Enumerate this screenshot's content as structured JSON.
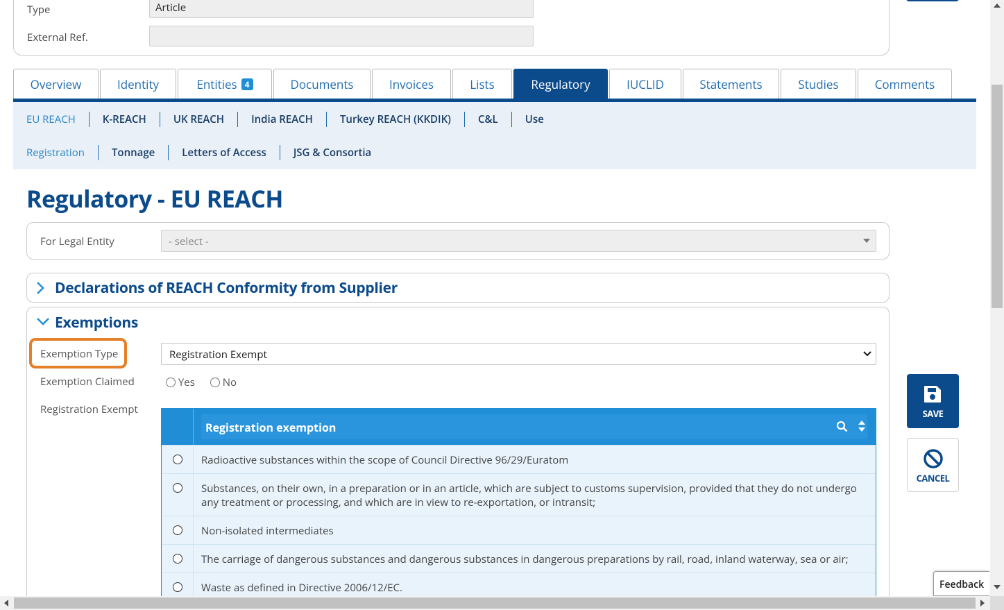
{
  "top_form": {
    "type_label": "Type",
    "type_value": "Article",
    "external_ref_label": "External Ref.",
    "external_ref_value": ""
  },
  "tabs": [
    {
      "label": "Overview"
    },
    {
      "label": "Identity"
    },
    {
      "label": "Entities",
      "badge": "4"
    },
    {
      "label": "Documents"
    },
    {
      "label": "Invoices"
    },
    {
      "label": "Lists"
    },
    {
      "label": "Regulatory",
      "active": true
    },
    {
      "label": "IUCLID"
    },
    {
      "label": "Statements"
    },
    {
      "label": "Studies"
    },
    {
      "label": "Comments"
    }
  ],
  "subnav": {
    "regions": [
      "EU REACH",
      "K-REACH",
      "UK REACH",
      "India REACH",
      "Turkey REACH (KKDIK)",
      "C&L",
      "Use"
    ],
    "sections": [
      "Registration",
      "Tonnage",
      "Letters of Access",
      "JSG & Consortia"
    ]
  },
  "page_title": "Regulatory - EU REACH",
  "legal_entity": {
    "label": "For Legal Entity",
    "placeholder": "- select -"
  },
  "declarations": {
    "title": "Declarations of REACH Conformity from Supplier"
  },
  "exemptions": {
    "title": "Exemptions",
    "type_label": "Exemption Type",
    "type_value": "Registration Exempt",
    "claimed_label": "Exemption Claimed",
    "claimed_yes": "Yes",
    "claimed_no": "No",
    "reg_exempt_label": "Registration Exempt",
    "grid_header": "Registration exemption",
    "rows": [
      "Radioactive substances within the scope of Council Directive 96/29/Euratom",
      "Substances, on their own, in a preparation or in an article, which are subject to customs supervision, provided that they do not undergo any treatment or processing, and which are in view to re-exportation, or intransit;",
      "Non-isolated intermediates",
      "The carriage of dangerous substances and dangerous substances in dangerous preparations by rail, road, inland waterway, sea or air;",
      "Waste as defined in Directive 2006/12/EC."
    ]
  },
  "actions": {
    "save_label": "SAVE",
    "cancel_label": "CANCEL"
  },
  "feedback_label": "Feedback",
  "colors": {
    "brand_dark": "#0b4a8b",
    "brand_light": "#1f8ed6",
    "highlight": "#e47f2a"
  }
}
